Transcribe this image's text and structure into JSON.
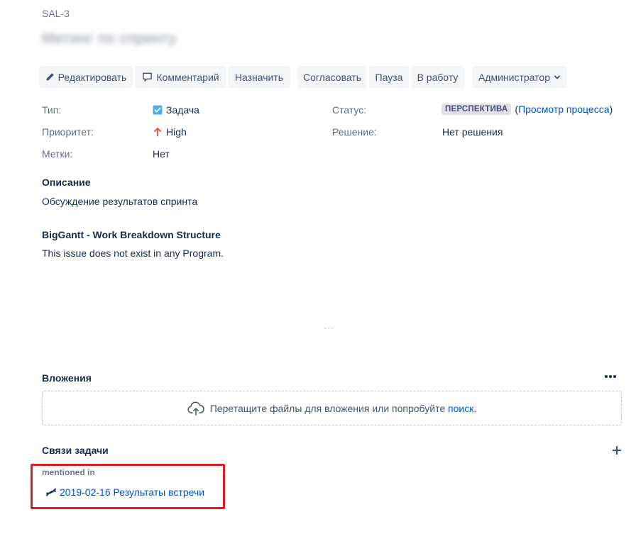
{
  "issue": {
    "key": "SAL-3",
    "summary": "Митинг по спринту"
  },
  "toolbar": {
    "edit_label": "Редактировать",
    "comment_label": "Комментарий",
    "assign_label": "Назначить",
    "approve_label": "Согласовать",
    "pause_label": "Пауза",
    "in_progress_label": "В работу",
    "admin_label": "Администратор"
  },
  "fields": {
    "type_label": "Тип:",
    "type_value": "Задача",
    "priority_label": "Приоритет:",
    "priority_value": "High",
    "labels_label": "Метки:",
    "labels_value": "Нет",
    "status_label": "Статус:",
    "status_value": "ПЕРСПЕКТИВА",
    "status_open_paren": "(",
    "workflow_link": "Просмотр процесса",
    "status_close_paren": ")",
    "resolution_label": "Решение:",
    "resolution_value": "Нет решения"
  },
  "description": {
    "title": "Описание",
    "text": "Обсуждение результатов спринта"
  },
  "biggantt": {
    "title": "BigGantt - Work Breakdown Structure",
    "text": "This issue does not exist in any Program."
  },
  "divider": "···",
  "attachments": {
    "title": "Вложения",
    "drop_text": "Перетащите файлы для вложения или попробуйте",
    "browse_link": "поиск",
    "drop_suffix": "."
  },
  "links": {
    "title": "Связи задачи",
    "relation": "mentioned in",
    "item": "2019-02-16 Результаты встречи"
  },
  "colors": {
    "link": "#0052cc",
    "highlight": "#e01b22",
    "priority_high": "#e5493a",
    "task_icon": "#4bade8"
  }
}
